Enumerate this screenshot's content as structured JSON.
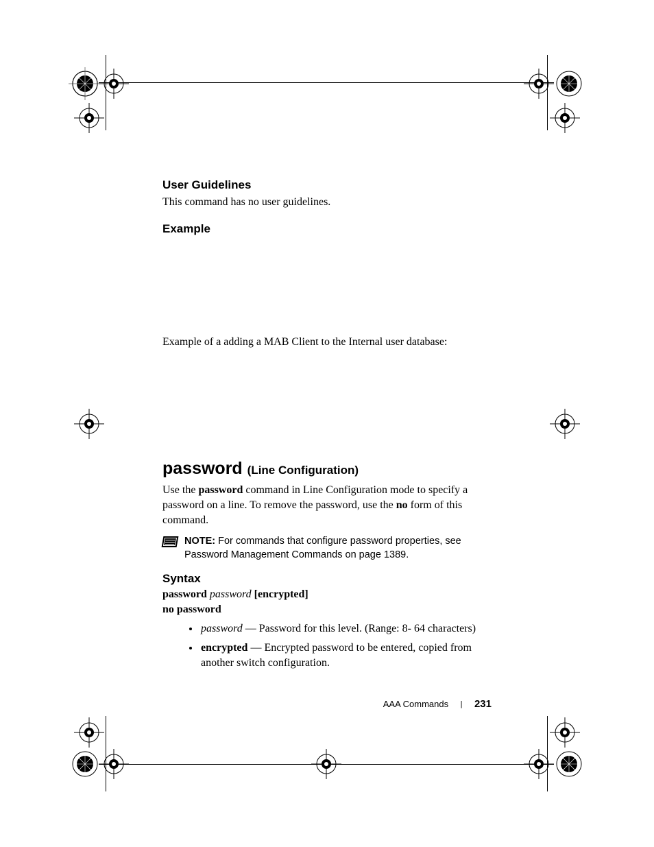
{
  "headings": {
    "user_guidelines": "User Guidelines",
    "example": "Example",
    "syntax": "Syntax"
  },
  "body": {
    "no_guidelines": "This command has no user guidelines.",
    "example_intro": "Example of a adding a MAB Client to the Internal user database:"
  },
  "section": {
    "title": "password",
    "subtitle": "(Line Configuration)",
    "use_pre": "Use the ",
    "use_cmd": "password",
    "use_mid": " command in Line Configuration mode to specify a password on a line. To remove the password, use the ",
    "use_no": "no",
    "use_post": " form of this command."
  },
  "note": {
    "label": "NOTE:",
    "text": " For commands that configure password properties, see Password Management Commands on page 1389."
  },
  "syntax": {
    "line1_cmd": "password",
    "line1_arg": "password",
    "line1_opt": "[encrypted]",
    "line2": "no password"
  },
  "params": [
    {
      "term_italic": "password",
      "desc": " — Password for this level. (Range: 8- 64 characters)"
    },
    {
      "term_bold": "encrypted",
      "desc": " — Encrypted password to be entered, copied from another switch configuration."
    }
  ],
  "footer": {
    "section": "AAA Commands",
    "page": "231"
  }
}
